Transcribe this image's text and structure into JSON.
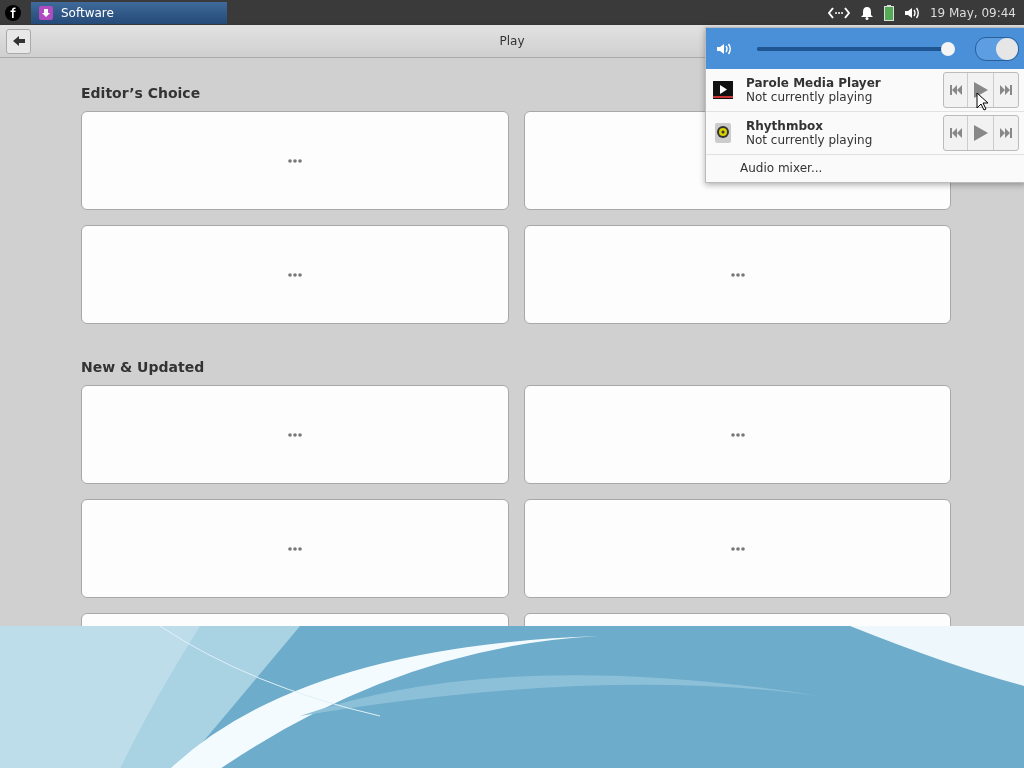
{
  "panel": {
    "task": {
      "label": "Software",
      "selected": true
    },
    "clock": "19 May, 09:44"
  },
  "window": {
    "title": "Play",
    "sections": [
      {
        "title": "Editor’s Choice",
        "cards": [
          {
            "kind": "placeholder"
          },
          {
            "kind": "placeholder"
          },
          {
            "kind": "placeholder"
          },
          {
            "kind": "placeholder"
          }
        ]
      },
      {
        "title": "New & Updated",
        "cards": [
          {
            "kind": "placeholder"
          },
          {
            "kind": "placeholder"
          },
          {
            "kind": "placeholder"
          },
          {
            "kind": "placeholder"
          },
          {
            "kind": "placeholder"
          },
          {
            "kind": "placeholder"
          }
        ]
      }
    ]
  },
  "sound_menu": {
    "volume": {
      "level": 0.99
    },
    "output": {
      "on": true
    },
    "players": [
      {
        "kind": "parole",
        "name": "Parole Media Player",
        "status": "Not currently playing"
      },
      {
        "kind": "rhythmbox",
        "name": "Rhythmbox",
        "status": "Not currently playing"
      }
    ],
    "mixer": "Audio mixer..."
  }
}
